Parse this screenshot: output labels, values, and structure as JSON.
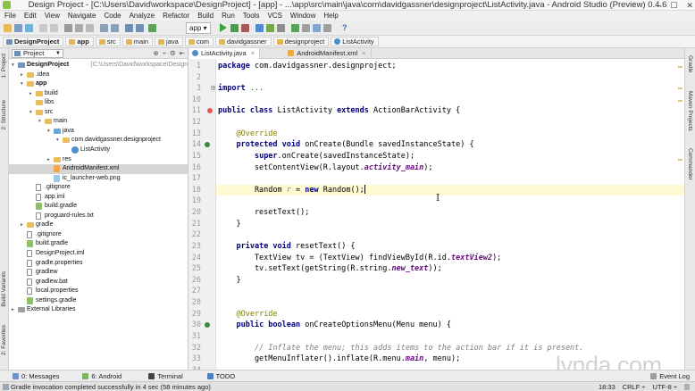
{
  "window": {
    "title": "Design Project - [C:\\Users\\David\\workspace\\DesignProject] - [app] - ...\\app\\src\\main\\java\\com\\davidgassner\\designproject\\ListActivity.java - Android Studio (Preview) 0.4.6",
    "minimize": "–",
    "maximize": "☐",
    "close": "✕"
  },
  "menu": [
    "File",
    "Edit",
    "View",
    "Navigate",
    "Code",
    "Analyze",
    "Refactor",
    "Build",
    "Run",
    "Tools",
    "VCS",
    "Window",
    "Help"
  ],
  "toolbar": {
    "run_config": "app ▾",
    "help_icon": "?"
  },
  "breadcrumbs": [
    "DesignProject",
    "app",
    "src",
    "main",
    "java",
    "com",
    "davidgassner",
    "designproject",
    "ListActivity"
  ],
  "side_tabs": {
    "left": [
      "1: Project",
      "2: Structure",
      "Build Variants",
      "2: Favorites"
    ],
    "right": [
      "Gradle",
      "Maven Projects",
      "Commander"
    ]
  },
  "project_panel": {
    "view_selector": "Project",
    "tools": [
      "⊕",
      "÷",
      "⚙",
      "⇤"
    ],
    "tree": [
      {
        "label": "DesignProject",
        "path": " (C:\\Users\\David\\workspace\\DesignProject)",
        "depth": 0,
        "twisty": "▾",
        "icon": "proj",
        "bold": true
      },
      {
        "label": ".idea",
        "depth": 1,
        "twisty": "▸",
        "icon": "folder"
      },
      {
        "label": "app",
        "depth": 1,
        "twisty": "▾",
        "icon": "folder",
        "bold": true
      },
      {
        "label": "build",
        "depth": 2,
        "twisty": "▸",
        "icon": "folder"
      },
      {
        "label": "libs",
        "depth": 2,
        "twisty": "",
        "icon": "folder"
      },
      {
        "label": "src",
        "depth": 2,
        "twisty": "▾",
        "icon": "folder"
      },
      {
        "label": "main",
        "depth": 3,
        "twisty": "▾",
        "icon": "folder"
      },
      {
        "label": "java",
        "depth": 4,
        "twisty": "▾",
        "icon": "src"
      },
      {
        "label": "com.davidgassner.designproject",
        "depth": 5,
        "twisty": "▾",
        "icon": "folder"
      },
      {
        "label": "ListActivity",
        "depth": 6,
        "twisty": "",
        "icon": "cls"
      },
      {
        "label": "res",
        "depth": 4,
        "twisty": "▸",
        "icon": "folder"
      },
      {
        "label": "AndroidManifest.xml",
        "depth": 4,
        "twisty": "",
        "icon": "xml",
        "selected": true
      },
      {
        "label": "ic_launcher-web.png",
        "depth": 4,
        "twisty": "",
        "icon": "png"
      },
      {
        "label": ".gitignore",
        "depth": 2,
        "twisty": "",
        "icon": "file"
      },
      {
        "label": "app.iml",
        "depth": 2,
        "twisty": "",
        "icon": "file"
      },
      {
        "label": "build.gradle",
        "depth": 2,
        "twisty": "",
        "icon": "gradle"
      },
      {
        "label": "proguard-rules.txt",
        "depth": 2,
        "twisty": "",
        "icon": "file"
      },
      {
        "label": "gradle",
        "depth": 1,
        "twisty": "▸",
        "icon": "folder"
      },
      {
        "label": ".gitignore",
        "depth": 1,
        "twisty": "",
        "icon": "file"
      },
      {
        "label": "build.gradle",
        "depth": 1,
        "twisty": "",
        "icon": "gradle"
      },
      {
        "label": "DesignProject.iml",
        "depth": 1,
        "twisty": "",
        "icon": "file"
      },
      {
        "label": "gradle.properties",
        "depth": 1,
        "twisty": "",
        "icon": "file"
      },
      {
        "label": "gradlew",
        "depth": 1,
        "twisty": "",
        "icon": "file"
      },
      {
        "label": "gradlew.bat",
        "depth": 1,
        "twisty": "",
        "icon": "file"
      },
      {
        "label": "local.properties",
        "depth": 1,
        "twisty": "",
        "icon": "file"
      },
      {
        "label": "settings.gradle",
        "depth": 1,
        "twisty": "",
        "icon": "gradle"
      },
      {
        "label": "External Libraries",
        "depth": 0,
        "twisty": "▸",
        "icon": "ext"
      }
    ]
  },
  "editor": {
    "tabs": [
      {
        "label": "ListActivity.java",
        "kind": "java",
        "active": true
      },
      {
        "label": "AndroidManifest.xml",
        "kind": "xml",
        "active": false
      }
    ],
    "tab_close": "×",
    "current_line": 18,
    "lines": [
      {
        "n": "1",
        "segs": [
          [
            "kw",
            "package "
          ],
          [
            "",
            "com.davidgassner.designproject;"
          ]
        ]
      },
      {
        "n": "2",
        "segs": []
      },
      {
        "n": "3",
        "fold": true,
        "segs": [
          [
            "kw",
            "import "
          ],
          [
            "fold",
            "..."
          ]
        ]
      },
      {
        "n": "10",
        "segs": []
      },
      {
        "n": "11",
        "segs": [
          [
            "kw",
            "public class "
          ],
          [
            "",
            "ListActivity "
          ],
          [
            "kw",
            "extends "
          ],
          [
            "",
            "ActionBarActivity {"
          ]
        ]
      },
      {
        "n": "12",
        "segs": []
      },
      {
        "n": "13",
        "segs": [
          [
            "",
            "    "
          ],
          [
            "an",
            "@Override"
          ]
        ]
      },
      {
        "n": "14",
        "segs": [
          [
            "",
            "    "
          ],
          [
            "kw",
            "protected void "
          ],
          [
            "",
            "onCreate(Bundle savedInstanceState) {"
          ]
        ]
      },
      {
        "n": "15",
        "segs": [
          [
            "",
            "        "
          ],
          [
            "kw",
            "super"
          ],
          [
            "",
            ".onCreate(savedInstanceState);"
          ]
        ]
      },
      {
        "n": "16",
        "segs": [
          [
            "",
            "        setContentView(R.layout."
          ],
          [
            "st",
            "activity_main"
          ],
          [
            "",
            ");"
          ]
        ]
      },
      {
        "n": "17",
        "segs": []
      },
      {
        "n": "18",
        "segs": [
          [
            "",
            "        Random "
          ],
          [
            "cm",
            "r"
          ],
          [
            "",
            " = "
          ],
          [
            "kw",
            "new "
          ],
          [
            "",
            "Random();"
          ]
        ],
        "caret": true
      },
      {
        "n": "19",
        "segs": []
      },
      {
        "n": "20",
        "segs": [
          [
            "",
            "        resetText();"
          ]
        ]
      },
      {
        "n": "21",
        "segs": [
          [
            "",
            "    }"
          ]
        ]
      },
      {
        "n": "22",
        "segs": []
      },
      {
        "n": "23",
        "segs": [
          [
            "",
            "    "
          ],
          [
            "kw",
            "private void "
          ],
          [
            "",
            "resetText() {"
          ]
        ]
      },
      {
        "n": "24",
        "segs": [
          [
            "",
            "        TextView tv = (TextView) findViewById(R.id."
          ],
          [
            "st",
            "textView2"
          ],
          [
            "",
            ");"
          ]
        ]
      },
      {
        "n": "25",
        "segs": [
          [
            "",
            "        tv.setText(getString(R.string."
          ],
          [
            "st",
            "new_text"
          ],
          [
            "",
            "));"
          ]
        ]
      },
      {
        "n": "26",
        "segs": [
          [
            "",
            "    }"
          ]
        ]
      },
      {
        "n": "27",
        "segs": []
      },
      {
        "n": "28",
        "segs": []
      },
      {
        "n": "29",
        "segs": [
          [
            "",
            "    "
          ],
          [
            "an",
            "@Override"
          ]
        ]
      },
      {
        "n": "30",
        "segs": [
          [
            "",
            "    "
          ],
          [
            "kw",
            "public boolean "
          ],
          [
            "",
            "onCreateOptionsMenu(Menu menu) {"
          ]
        ]
      },
      {
        "n": "31",
        "segs": []
      },
      {
        "n": "32",
        "segs": [
          [
            "",
            "        "
          ],
          [
            "cm",
            "// Inflate the menu; this adds items to the action bar if it is present."
          ]
        ]
      },
      {
        "n": "33",
        "segs": [
          [
            "",
            "        getMenuInflater().inflate(R.menu."
          ],
          [
            "st",
            "main"
          ],
          [
            "",
            ", menu);"
          ]
        ]
      },
      {
        "n": "34",
        "segs": []
      }
    ]
  },
  "bottom_tools": [
    {
      "label": "0: Messages",
      "color": "#6f93c9"
    },
    {
      "label": "6: Android",
      "color": "#7bb661"
    },
    {
      "label": "Terminal",
      "color": "#444444"
    },
    {
      "label": "TODO",
      "color": "#4e7fbf"
    }
  ],
  "event_log": "Event Log",
  "status": {
    "message": "Gradle invocation completed successfully in 4 sec (58 minutes ago)",
    "position": "18:33",
    "line_sep": "CRLF ÷",
    "encoding": "UTF-8 ÷"
  },
  "watermark": "lynda.com"
}
